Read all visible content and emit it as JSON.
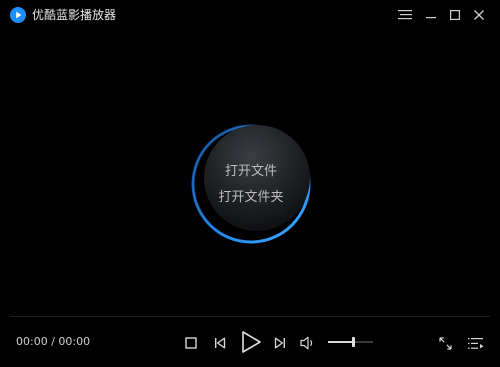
{
  "window": {
    "title": "优酷蓝影播放器",
    "buttons": [
      "menu-icon",
      "minimize-icon",
      "maximize-icon",
      "close-icon"
    ]
  },
  "center": {
    "open_file": "打开文件",
    "open_folder": "打开文件夹"
  },
  "controls": {
    "time": "00:00 / 00:00",
    "icons": [
      "stop-icon",
      "previous-icon",
      "play-icon",
      "next-icon",
      "volume-icon",
      "fullscreen-icon",
      "playlist-icon"
    ],
    "volume_level": 0.55
  },
  "colors": {
    "background": "#000000",
    "accent_blue": "#1e8fff",
    "text": "#d8d8d8"
  }
}
